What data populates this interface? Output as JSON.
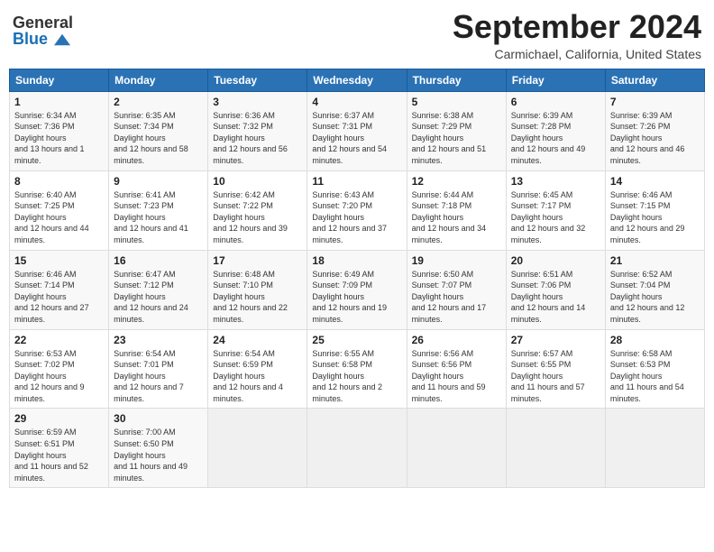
{
  "header": {
    "logo_general": "General",
    "logo_blue": "Blue",
    "month_title": "September 2024",
    "location": "Carmichael, California, United States"
  },
  "calendar": {
    "weekdays": [
      "Sunday",
      "Monday",
      "Tuesday",
      "Wednesday",
      "Thursday",
      "Friday",
      "Saturday"
    ],
    "weeks": [
      [
        {
          "day": "1",
          "sunrise": "6:34 AM",
          "sunset": "7:36 PM",
          "daylight": "13 hours and 1 minute."
        },
        {
          "day": "2",
          "sunrise": "6:35 AM",
          "sunset": "7:34 PM",
          "daylight": "12 hours and 58 minutes."
        },
        {
          "day": "3",
          "sunrise": "6:36 AM",
          "sunset": "7:32 PM",
          "daylight": "12 hours and 56 minutes."
        },
        {
          "day": "4",
          "sunrise": "6:37 AM",
          "sunset": "7:31 PM",
          "daylight": "12 hours and 54 minutes."
        },
        {
          "day": "5",
          "sunrise": "6:38 AM",
          "sunset": "7:29 PM",
          "daylight": "12 hours and 51 minutes."
        },
        {
          "day": "6",
          "sunrise": "6:39 AM",
          "sunset": "7:28 PM",
          "daylight": "12 hours and 49 minutes."
        },
        {
          "day": "7",
          "sunrise": "6:39 AM",
          "sunset": "7:26 PM",
          "daylight": "12 hours and 46 minutes."
        }
      ],
      [
        {
          "day": "8",
          "sunrise": "6:40 AM",
          "sunset": "7:25 PM",
          "daylight": "12 hours and 44 minutes."
        },
        {
          "day": "9",
          "sunrise": "6:41 AM",
          "sunset": "7:23 PM",
          "daylight": "12 hours and 41 minutes."
        },
        {
          "day": "10",
          "sunrise": "6:42 AM",
          "sunset": "7:22 PM",
          "daylight": "12 hours and 39 minutes."
        },
        {
          "day": "11",
          "sunrise": "6:43 AM",
          "sunset": "7:20 PM",
          "daylight": "12 hours and 37 minutes."
        },
        {
          "day": "12",
          "sunrise": "6:44 AM",
          "sunset": "7:18 PM",
          "daylight": "12 hours and 34 minutes."
        },
        {
          "day": "13",
          "sunrise": "6:45 AM",
          "sunset": "7:17 PM",
          "daylight": "12 hours and 32 minutes."
        },
        {
          "day": "14",
          "sunrise": "6:46 AM",
          "sunset": "7:15 PM",
          "daylight": "12 hours and 29 minutes."
        }
      ],
      [
        {
          "day": "15",
          "sunrise": "6:46 AM",
          "sunset": "7:14 PM",
          "daylight": "12 hours and 27 minutes."
        },
        {
          "day": "16",
          "sunrise": "6:47 AM",
          "sunset": "7:12 PM",
          "daylight": "12 hours and 24 minutes."
        },
        {
          "day": "17",
          "sunrise": "6:48 AM",
          "sunset": "7:10 PM",
          "daylight": "12 hours and 22 minutes."
        },
        {
          "day": "18",
          "sunrise": "6:49 AM",
          "sunset": "7:09 PM",
          "daylight": "12 hours and 19 minutes."
        },
        {
          "day": "19",
          "sunrise": "6:50 AM",
          "sunset": "7:07 PM",
          "daylight": "12 hours and 17 minutes."
        },
        {
          "day": "20",
          "sunrise": "6:51 AM",
          "sunset": "7:06 PM",
          "daylight": "12 hours and 14 minutes."
        },
        {
          "day": "21",
          "sunrise": "6:52 AM",
          "sunset": "7:04 PM",
          "daylight": "12 hours and 12 minutes."
        }
      ],
      [
        {
          "day": "22",
          "sunrise": "6:53 AM",
          "sunset": "7:02 PM",
          "daylight": "12 hours and 9 minutes."
        },
        {
          "day": "23",
          "sunrise": "6:54 AM",
          "sunset": "7:01 PM",
          "daylight": "12 hours and 7 minutes."
        },
        {
          "day": "24",
          "sunrise": "6:54 AM",
          "sunset": "6:59 PM",
          "daylight": "12 hours and 4 minutes."
        },
        {
          "day": "25",
          "sunrise": "6:55 AM",
          "sunset": "6:58 PM",
          "daylight": "12 hours and 2 minutes."
        },
        {
          "day": "26",
          "sunrise": "6:56 AM",
          "sunset": "6:56 PM",
          "daylight": "11 hours and 59 minutes."
        },
        {
          "day": "27",
          "sunrise": "6:57 AM",
          "sunset": "6:55 PM",
          "daylight": "11 hours and 57 minutes."
        },
        {
          "day": "28",
          "sunrise": "6:58 AM",
          "sunset": "6:53 PM",
          "daylight": "11 hours and 54 minutes."
        }
      ],
      [
        {
          "day": "29",
          "sunrise": "6:59 AM",
          "sunset": "6:51 PM",
          "daylight": "11 hours and 52 minutes."
        },
        {
          "day": "30",
          "sunrise": "7:00 AM",
          "sunset": "6:50 PM",
          "daylight": "11 hours and 49 minutes."
        },
        null,
        null,
        null,
        null,
        null
      ]
    ]
  }
}
